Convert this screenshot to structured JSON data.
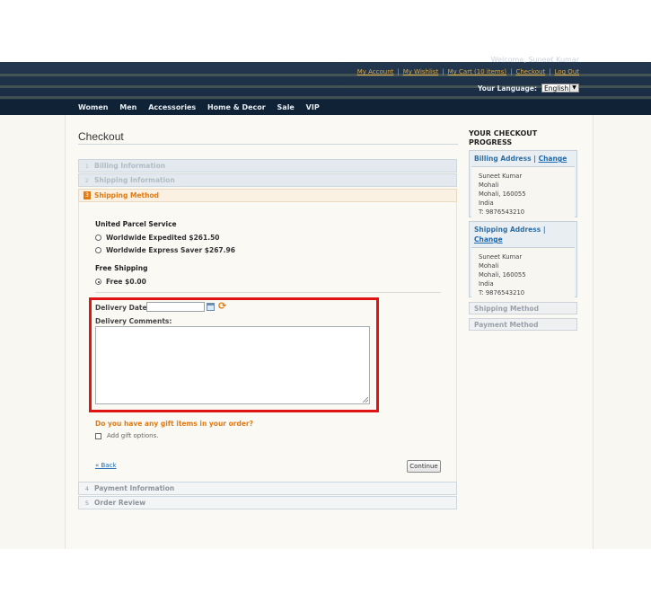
{
  "header": {
    "welcome": "Welcome, Suneet Kumar",
    "links": [
      "My Account",
      "My Wishlist",
      "My Cart (10 items)",
      "Checkout",
      "Log Out"
    ],
    "language_label": "Your Language:",
    "language_value": "English"
  },
  "nav": {
    "items": [
      "Women",
      "Men",
      "Accessories",
      "Home & Decor",
      "Sale",
      "VIP"
    ]
  },
  "checkout": {
    "title": "Checkout",
    "steps": [
      {
        "num": "1",
        "label": "Billing Information"
      },
      {
        "num": "2",
        "label": "Shipping Information"
      },
      {
        "num": "3",
        "label": "Shipping Method"
      },
      {
        "num": "4",
        "label": "Payment Information"
      },
      {
        "num": "5",
        "label": "Order Review"
      }
    ],
    "shipping": {
      "ups_title": "United Parcel Service",
      "ups_options": [
        "Worldwide Expedited $261.50",
        "Worldwide Express Saver $267.96"
      ],
      "free_title": "Free Shipping",
      "free_option": "Free $0.00"
    },
    "delivery_date_label": "Delivery Date:",
    "delivery_date_value": "",
    "delivery_comments_label": "Delivery Comments:",
    "delivery_comments_value": "",
    "gift_question": "Do you have any gift items in your order?",
    "gift_option": "Add gift options.",
    "back_link": "« Back",
    "continue_button": "Continue"
  },
  "progress": {
    "title": "YOUR CHECKOUT PROGRESS",
    "billing": {
      "title": "Billing Address",
      "separator": "|",
      "change": "Change",
      "lines": [
        "Suneet Kumar",
        "Mohali",
        "Mohali, 160055",
        "India",
        "T: 9876543210"
      ]
    },
    "shipping": {
      "title": "Shipping Address",
      "separator": "|",
      "change": "Change",
      "lines": [
        "Suneet Kumar",
        "Mohali",
        "Mohali, 160055",
        "India",
        "T: 9876543210"
      ]
    },
    "shipping_method": "Shipping Method",
    "payment_method": "Payment Method"
  },
  "colors": {
    "accent": "#e07b14",
    "highlight_border": "#e01414",
    "header_bg": "#1a2d44",
    "link": "#1e6ab0"
  }
}
